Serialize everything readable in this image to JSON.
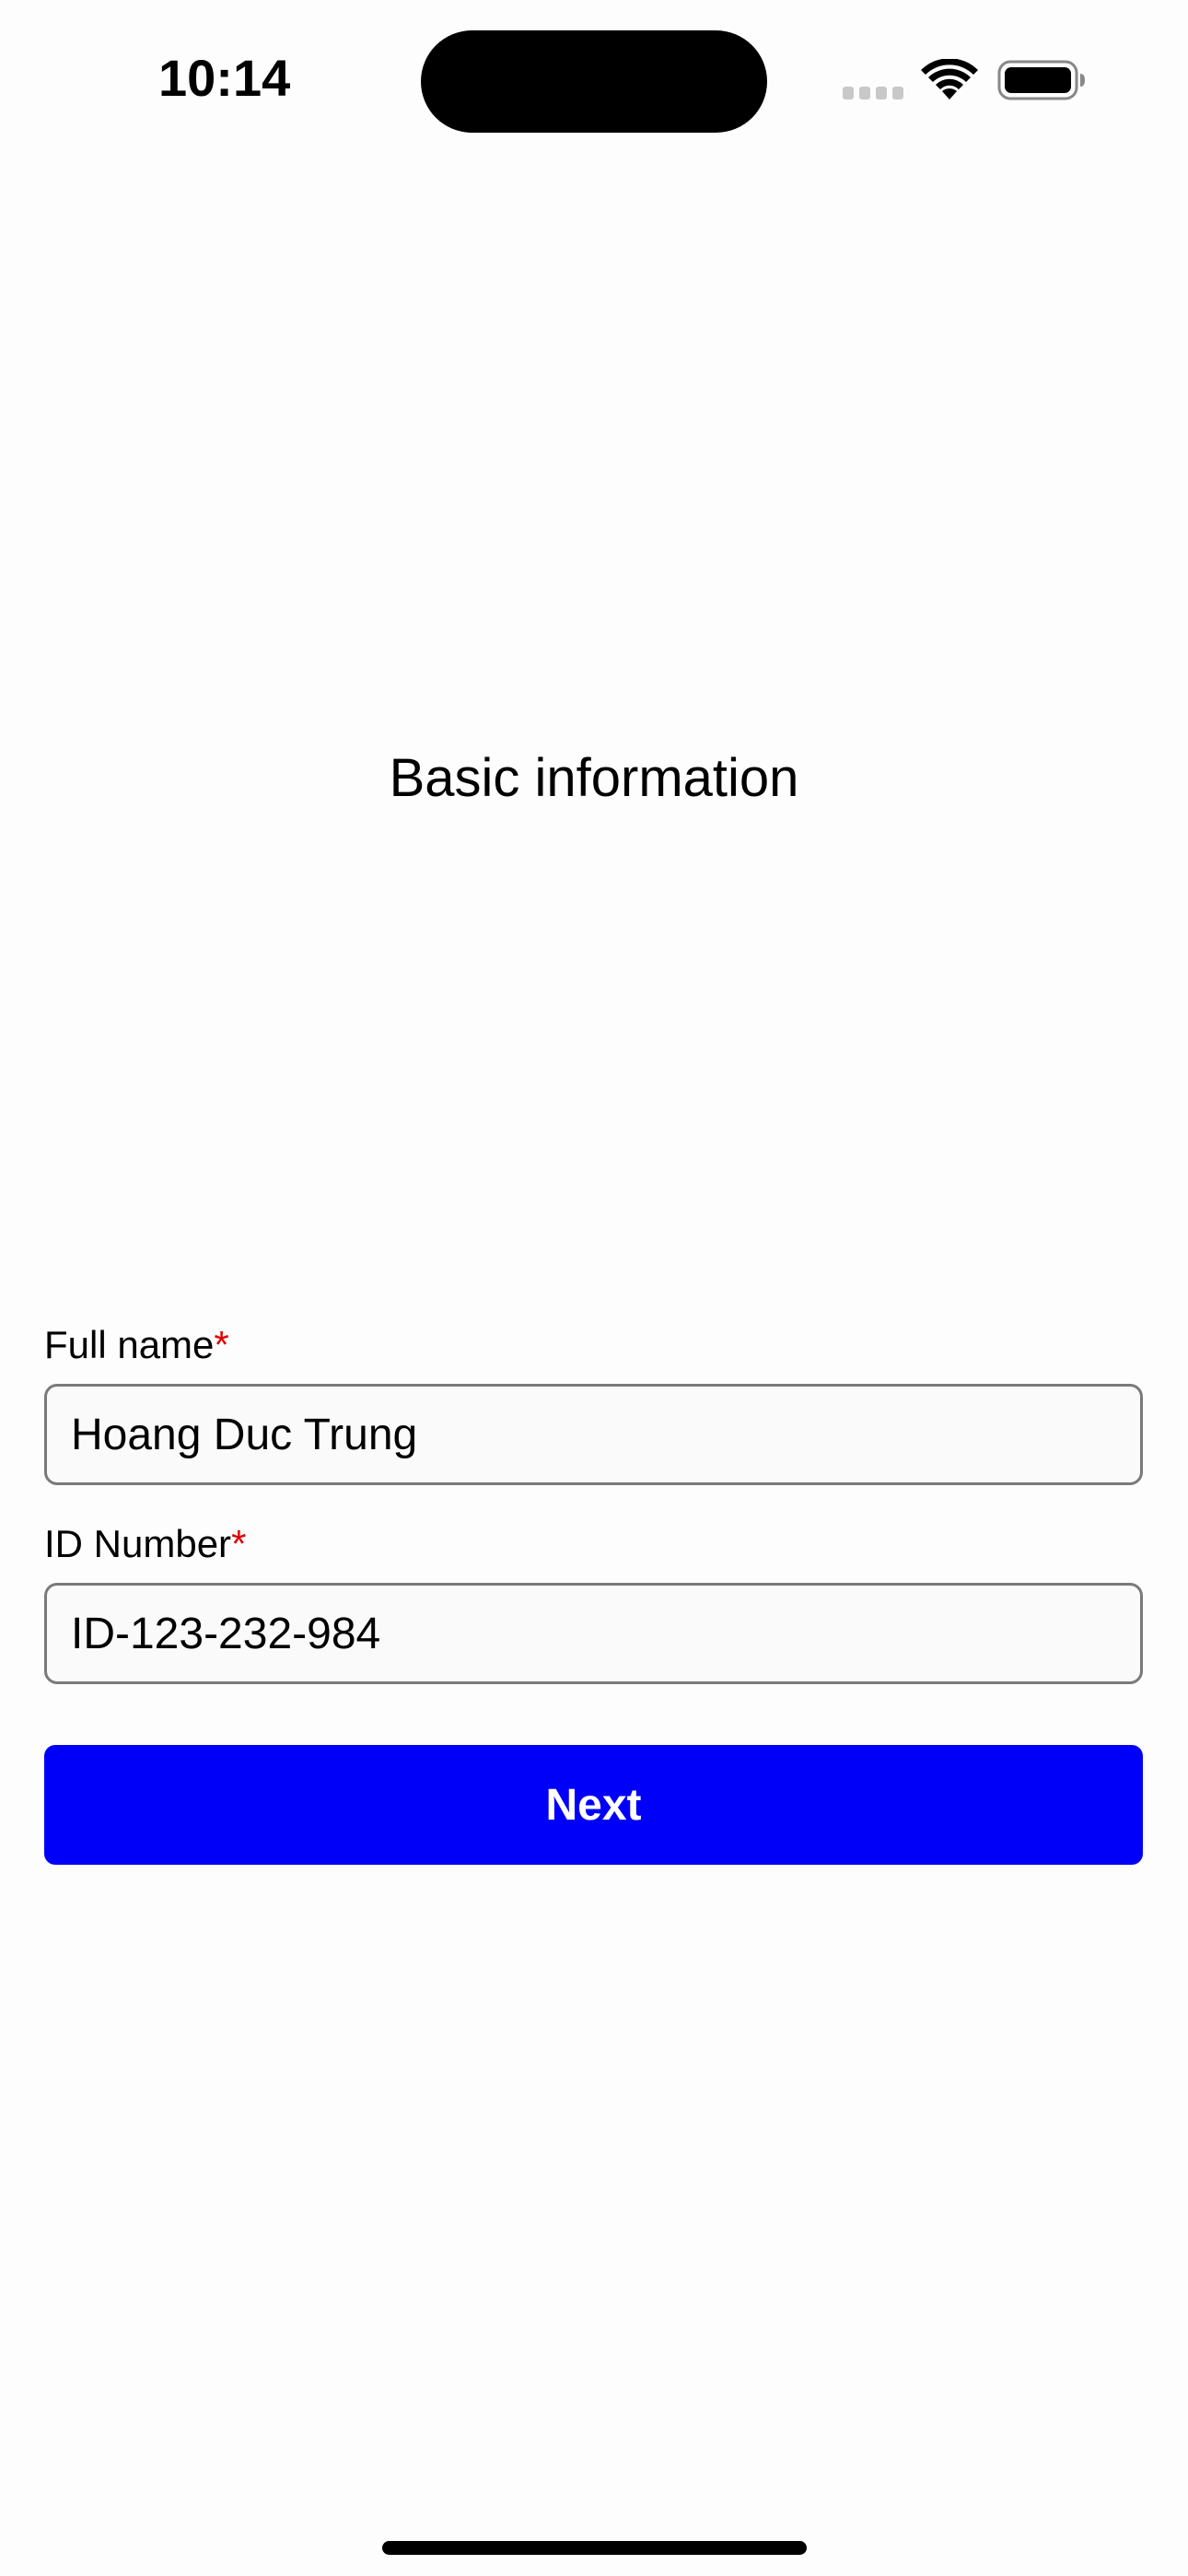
{
  "status_bar": {
    "time": "10:14"
  },
  "page": {
    "title": "Basic information"
  },
  "form": {
    "full_name": {
      "label": "Full name",
      "required_mark": "*",
      "value": "Hoang Duc Trung"
    },
    "id_number": {
      "label": "ID Number",
      "required_mark": "*",
      "value": "ID-123-232-984"
    },
    "next_label": "Next"
  },
  "colors": {
    "primary_button": "#0000FA",
    "required": "#E00000"
  }
}
